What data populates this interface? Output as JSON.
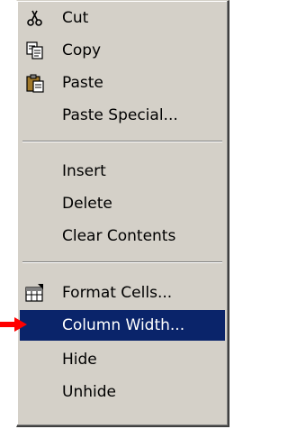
{
  "menu": {
    "items": [
      {
        "label": "Cut",
        "icon": "scissors-icon"
      },
      {
        "label": "Copy",
        "icon": "copy-icon"
      },
      {
        "label": "Paste",
        "icon": "clipboard-icon"
      },
      {
        "label": "Paste Special..."
      },
      {
        "label": "Insert"
      },
      {
        "label": "Delete"
      },
      {
        "label": "Clear Contents"
      },
      {
        "label": "Format Cells...",
        "icon": "format-cells-icon"
      },
      {
        "label": "Column Width...",
        "selected": true
      },
      {
        "label": "Hide"
      },
      {
        "label": "Unhide"
      }
    ]
  },
  "colors": {
    "menu_bg": "#d4d0c8",
    "highlight_bg": "#0a246a",
    "highlight_text": "#ffffff",
    "arrow": "#ff0000"
  }
}
